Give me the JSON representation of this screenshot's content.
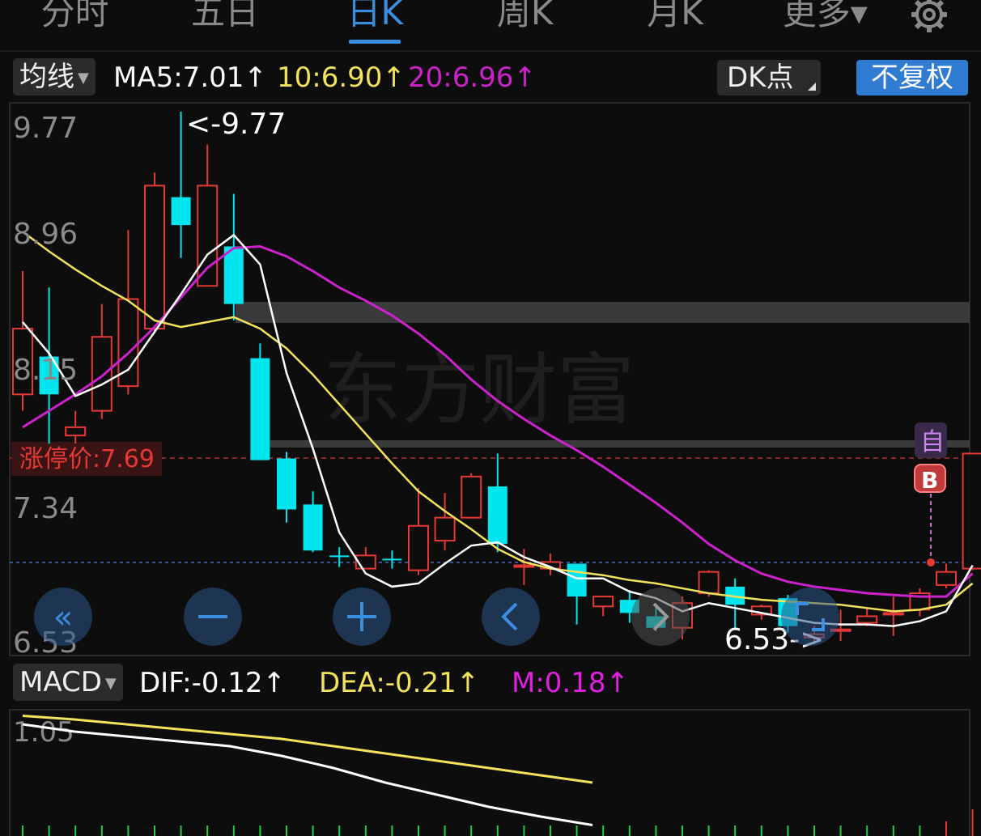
{
  "tabs": [
    {
      "label": "分时",
      "active": false
    },
    {
      "label": "五日",
      "active": false
    },
    {
      "label": "日K",
      "active": true
    },
    {
      "label": "周K",
      "active": false
    },
    {
      "label": "月K",
      "active": false
    },
    {
      "label": "更多▾",
      "active": false
    }
  ],
  "settings_icon": "gear-icon",
  "indicator_row": {
    "ma_select": "均线",
    "ma5": "MA5:7.01↑",
    "ma10": "10:6.90↑",
    "ma20": "20:6.96↑",
    "dk_button": "DK点",
    "fuquan_button": "不复权"
  },
  "price_axis": [
    "9.77",
    "8.96",
    "8.15",
    "7.34",
    "6.53"
  ],
  "price_high_marker": "<-9.77",
  "price_low_marker": "6.53->",
  "limit_up_label": "涨停价:7.69",
  "watermark": "东方财富",
  "marker_zi": "自",
  "marker_b": "B",
  "nav_buttons": [
    "«",
    "−",
    "+",
    "‹",
    "›"
  ],
  "macd_row": {
    "select": "MACD",
    "dif": "DIF:-0.12↑",
    "dea": "DEA:-0.21↑",
    "m": "M:0.18↑"
  },
  "macd_axis_top": "1.05",
  "colors": {
    "up": "#e53935",
    "down": "#00e5ee",
    "ma5": "#ffffff",
    "ma10": "#f2e35a",
    "ma20": "#cc22cc",
    "accent": "#3b8de0"
  },
  "chart_data": {
    "type": "candlestick",
    "ylim": [
      6.53,
      9.77
    ],
    "candles": [
      {
        "o": 8.05,
        "c": 8.45,
        "h": 8.8,
        "l": 7.95
      },
      {
        "o": 8.28,
        "c": 8.05,
        "h": 8.7,
        "l": 7.75
      },
      {
        "o": 7.8,
        "c": 7.85,
        "h": 7.95,
        "l": 7.75
      },
      {
        "o": 7.95,
        "c": 8.4,
        "h": 8.6,
        "l": 7.9
      },
      {
        "o": 8.1,
        "c": 8.63,
        "h": 9.05,
        "l": 8.05
      },
      {
        "o": 8.45,
        "c": 9.32,
        "h": 9.4,
        "l": 8.42
      },
      {
        "o": 9.25,
        "c": 9.08,
        "h": 9.77,
        "l": 8.88
      },
      {
        "o": 8.71,
        "c": 9.32,
        "h": 9.57,
        "l": 8.71
      },
      {
        "o": 8.95,
        "c": 8.6,
        "h": 9.27,
        "l": 8.5
      },
      {
        "o": 8.27,
        "c": 7.65,
        "h": 8.36,
        "l": 7.65
      },
      {
        "o": 7.66,
        "c": 7.35,
        "h": 7.7,
        "l": 7.27
      },
      {
        "o": 7.38,
        "c": 7.1,
        "h": 7.46,
        "l": 7.09
      },
      {
        "o": 7.07,
        "c": 7.06,
        "h": 7.12,
        "l": 7.0
      },
      {
        "o": 6.99,
        "c": 7.07,
        "h": 7.12,
        "l": 6.99
      },
      {
        "o": 7.05,
        "c": 7.04,
        "h": 7.1,
        "l": 6.99
      },
      {
        "o": 6.98,
        "c": 7.25,
        "h": 7.48,
        "l": 6.95
      },
      {
        "o": 7.16,
        "c": 7.3,
        "h": 7.45,
        "l": 7.1
      },
      {
        "o": 7.3,
        "c": 7.55,
        "h": 7.57,
        "l": 7.3
      },
      {
        "o": 7.49,
        "c": 7.14,
        "h": 7.69,
        "l": 7.09
      },
      {
        "o": 7.0,
        "c": 7.01,
        "h": 7.11,
        "l": 6.89
      },
      {
        "o": 6.99,
        "c": 7.03,
        "h": 7.08,
        "l": 6.95
      },
      {
        "o": 7.02,
        "c": 6.82,
        "h": 7.02,
        "l": 6.65
      },
      {
        "o": 6.76,
        "c": 6.82,
        "h": 6.82,
        "l": 6.7
      },
      {
        "o": 6.8,
        "c": 6.72,
        "h": 6.86,
        "l": 6.66
      },
      {
        "o": 6.7,
        "c": 6.63,
        "h": 6.76,
        "l": 6.61
      },
      {
        "o": 6.63,
        "c": 6.78,
        "h": 6.82,
        "l": 6.56
      },
      {
        "o": 6.84,
        "c": 6.97,
        "h": 6.98,
        "l": 6.82
      },
      {
        "o": 6.88,
        "c": 6.77,
        "h": 6.93,
        "l": 6.62
      },
      {
        "o": 6.71,
        "c": 6.76,
        "h": 6.77,
        "l": 6.68
      },
      {
        "o": 6.81,
        "c": 6.64,
        "h": 6.83,
        "l": 6.6
      },
      {
        "o": 6.57,
        "c": 6.59,
        "h": 6.64,
        "l": 6.53
      },
      {
        "o": 6.62,
        "c": 6.62,
        "h": 6.74,
        "l": 6.55
      },
      {
        "o": 6.66,
        "c": 6.7,
        "h": 6.75,
        "l": 6.64
      },
      {
        "o": 6.71,
        "c": 6.72,
        "h": 6.82,
        "l": 6.58
      },
      {
        "o": 6.74,
        "c": 6.84,
        "h": 6.87,
        "l": 6.7
      },
      {
        "o": 6.89,
        "c": 6.97,
        "h": 7.02,
        "l": 6.87
      },
      {
        "o": 6.99,
        "c": 7.69,
        "h": 7.69,
        "l": 6.98
      }
    ],
    "ma5": [
      8.49,
      8.3,
      8.04,
      8.11,
      8.2,
      8.43,
      8.66,
      8.9,
      9.02,
      8.84,
      8.18,
      7.72,
      7.21,
      6.96,
      6.88,
      6.9,
      7.02,
      7.13,
      7.15,
      7.06,
      7.0,
      6.93,
      6.93,
      6.85,
      6.81,
      6.73,
      6.78,
      6.75,
      6.72,
      6.69,
      6.66,
      6.65,
      6.65,
      6.64,
      6.67,
      6.73,
      7.01
    ],
    "ma10": [
      9.04,
      8.92,
      8.81,
      8.71,
      8.62,
      8.5,
      8.46,
      8.49,
      8.52,
      8.45,
      8.33,
      8.17,
      7.99,
      7.81,
      7.63,
      7.46,
      7.34,
      7.23,
      7.11,
      7.03,
      6.99,
      6.97,
      6.95,
      6.92,
      6.9,
      6.87,
      6.84,
      6.82,
      6.8,
      6.79,
      6.78,
      6.77,
      6.75,
      6.73,
      6.74,
      6.77,
      6.9
    ],
    "ma20": [
      7.85,
      7.95,
      8.05,
      8.16,
      8.3,
      8.46,
      8.64,
      8.82,
      8.94,
      8.95,
      8.89,
      8.8,
      8.7,
      8.62,
      8.53,
      8.42,
      8.29,
      8.14,
      8.01,
      7.9,
      7.8,
      7.71,
      7.61,
      7.5,
      7.39,
      7.27,
      7.14,
      7.04,
      6.96,
      6.91,
      6.88,
      6.86,
      6.84,
      6.83,
      6.82,
      6.82,
      6.96
    ],
    "macd_dif": [
      0.98,
      0.92,
      0.88,
      0.84,
      0.8,
      0.72,
      0.62,
      0.5,
      0.4,
      0.3,
      0.22,
      0.15
    ],
    "macd_dea": [
      1.05,
      1.02,
      0.98,
      0.94,
      0.9,
      0.86,
      0.8,
      0.74,
      0.68,
      0.62,
      0.56,
      0.5
    ]
  }
}
